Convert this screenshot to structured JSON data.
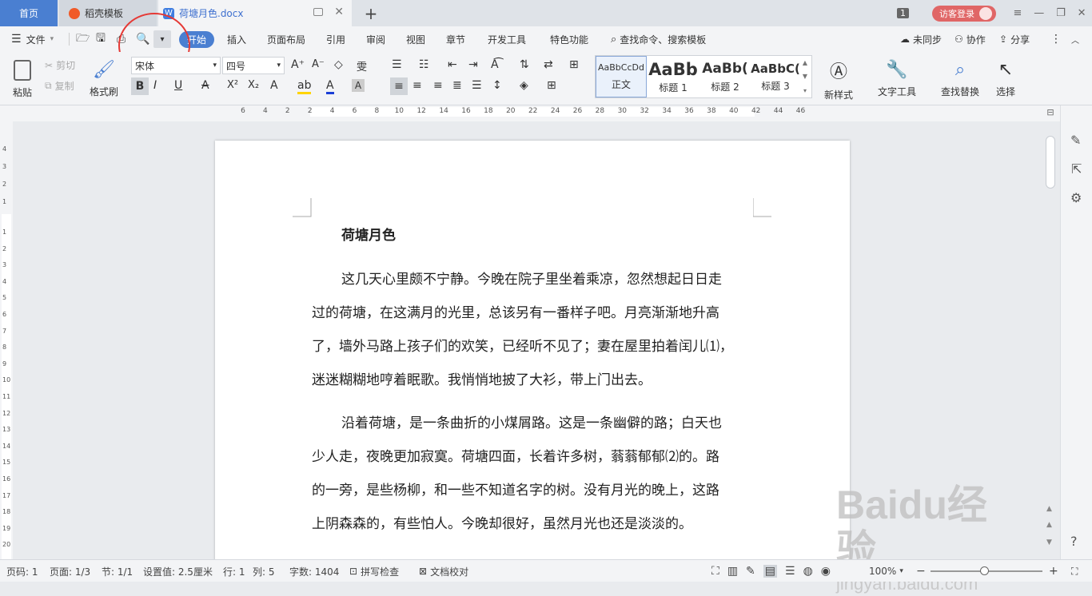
{
  "tabs": {
    "home": "首页",
    "daoke": "稻壳模板",
    "doc": "荷塘月色.docx",
    "add": "+"
  },
  "window": {
    "badge": "1",
    "login": "访客登录"
  },
  "menu": {
    "file": "文件",
    "items": [
      "开始",
      "插入",
      "页面布局",
      "引用",
      "审阅",
      "视图",
      "章节",
      "开发工具",
      "特色功能"
    ],
    "search": "查找命令、搜索模板",
    "sync": "未同步",
    "collab": "协作",
    "share": "分享"
  },
  "ribbon": {
    "paste": "粘贴",
    "cut": "剪切",
    "copy": "复制",
    "format_painter": "格式刷",
    "font_name": "宋体",
    "font_size": "四号",
    "styles": [
      "正文",
      "标题 1",
      "标题 2",
      "标题 3"
    ],
    "style_previews": [
      "AaBbCcDd",
      "AaBb",
      "AaBb(",
      "AaBbC("
    ],
    "new_style": "新样式",
    "text_tools": "文字工具",
    "find_replace": "查找替换",
    "select": "选择"
  },
  "ruler": {
    "h_ticks": [
      "6",
      "4",
      "2",
      "2",
      "4",
      "6",
      "8",
      "10",
      "12",
      "14",
      "16",
      "18",
      "20",
      "22",
      "24",
      "26",
      "28",
      "30",
      "32",
      "34",
      "36",
      "38",
      "40",
      "42",
      "44",
      "46"
    ],
    "v_ticks_top": [
      "4",
      "3",
      "2",
      "1"
    ],
    "v_ticks_bottom": [
      "1",
      "2",
      "3",
      "4",
      "5",
      "6",
      "7",
      "8",
      "9",
      "10",
      "11",
      "12",
      "13",
      "14",
      "15",
      "16",
      "17",
      "18",
      "19",
      "20"
    ]
  },
  "document": {
    "title": "荷塘月色",
    "paragraphs": [
      [
        "这几天心里颇不宁静。今晚在院子里坐着乘凉，忽然想起日日走",
        "过的荷塘，在这满月的光里，总该另有一番样子吧。月亮渐渐地升高",
        "了，墙外马路上孩子们的欢笑，已经听不见了；妻在屋里拍着闰儿⑴，",
        "迷迷糊糊地哼着眠歌。我悄悄地披了大衫，带上门出去。"
      ],
      [
        "沿着荷塘，是一条曲折的小煤屑路。这是一条幽僻的路；白天也",
        "少人走，夜晚更加寂寞。荷塘四面，长着许多树，蓊蓊郁郁⑵的。路",
        "的一旁，是些杨柳，和一些不知道名字的树。没有月光的晚上，这路",
        "上阴森森的，有些怕人。今晚却很好，虽然月光也还是淡淡的。"
      ]
    ]
  },
  "status": {
    "page_code": "页码: 1",
    "page": "页面: 1/3",
    "section": "节: 1/1",
    "setting": "设置值: 2.5厘米",
    "row": "行: 1",
    "col": "列: 5",
    "words": "字数: 1404",
    "spell": "拼写检查",
    "proof": "文档校对",
    "zoom": "100%"
  },
  "watermark": {
    "brand": "Baidu经验",
    "url": "jingyan.baidu.com"
  },
  "colors": {
    "accent": "#4a7fd1",
    "annotation": "#e53935",
    "login": "#e06666"
  }
}
